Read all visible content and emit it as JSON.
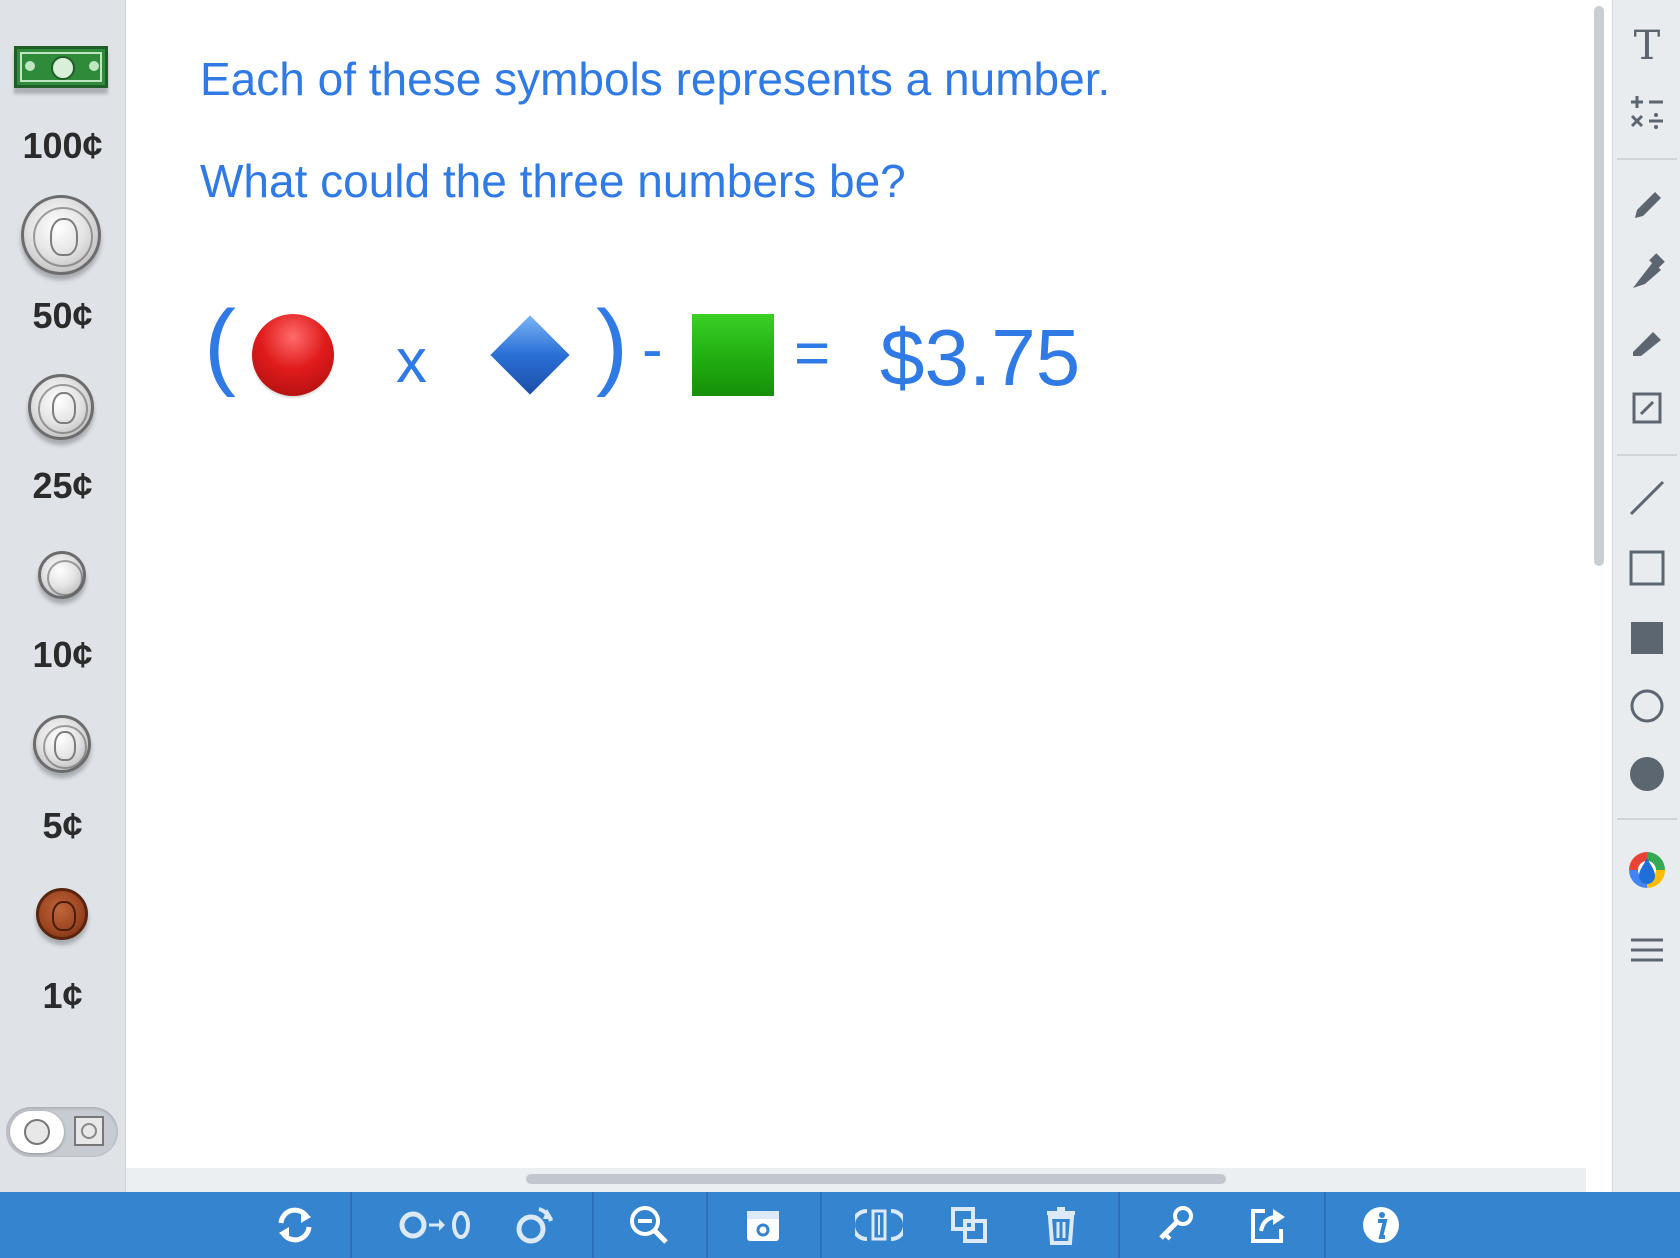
{
  "money_panel": {
    "items": [
      {
        "icon": "dollar-bill-icon",
        "label": "100¢"
      },
      {
        "icon": "half-dollar-coin-icon",
        "label": "50¢"
      },
      {
        "icon": "quarter-coin-icon",
        "label": "25¢"
      },
      {
        "icon": "dime-coin-icon",
        "label": "10¢"
      },
      {
        "icon": "nickel-coin-icon",
        "label": "5¢"
      },
      {
        "icon": "penny-coin-icon",
        "label": "1¢"
      }
    ],
    "toggle": {
      "left_icon": "coin-front-icon",
      "right_icon": "coin-back-icon"
    }
  },
  "canvas": {
    "line1": "Each of these symbols represents a number.",
    "line2": "What could the three numbers be?",
    "equation": {
      "open_paren": "(",
      "times": "x",
      "close_paren": ")",
      "minus": "-",
      "equals": "=",
      "result": "$3.75",
      "symbols": [
        {
          "name": "red-circle",
          "color": "#e01b1b"
        },
        {
          "name": "blue-diamond",
          "color": "#2a6fd6"
        },
        {
          "name": "green-square",
          "color": "#22b012"
        }
      ]
    }
  },
  "right_toolbar": {
    "tools": [
      "text-tool-icon",
      "math-symbols-icon",
      "pen-icon",
      "marker-icon",
      "highlighter-icon",
      "note-icon",
      "line-icon",
      "rectangle-outline-icon",
      "rectangle-filled-icon",
      "circle-outline-icon",
      "circle-filled-icon",
      "color-picker-icon",
      "menu-icon"
    ]
  },
  "bottom_toolbar": {
    "tools": [
      "reset-icon",
      "flip-coin-icon",
      "rotate-icon",
      "zoom-out-icon",
      "piggy-bank-icon",
      "swap-icon",
      "duplicate-icon",
      "trash-icon",
      "key-icon",
      "share-icon",
      "info-icon"
    ]
  },
  "colors": {
    "accent": "#2f7ae5",
    "bottom_bar": "#3584d0",
    "panel": "#dfe3e8"
  }
}
